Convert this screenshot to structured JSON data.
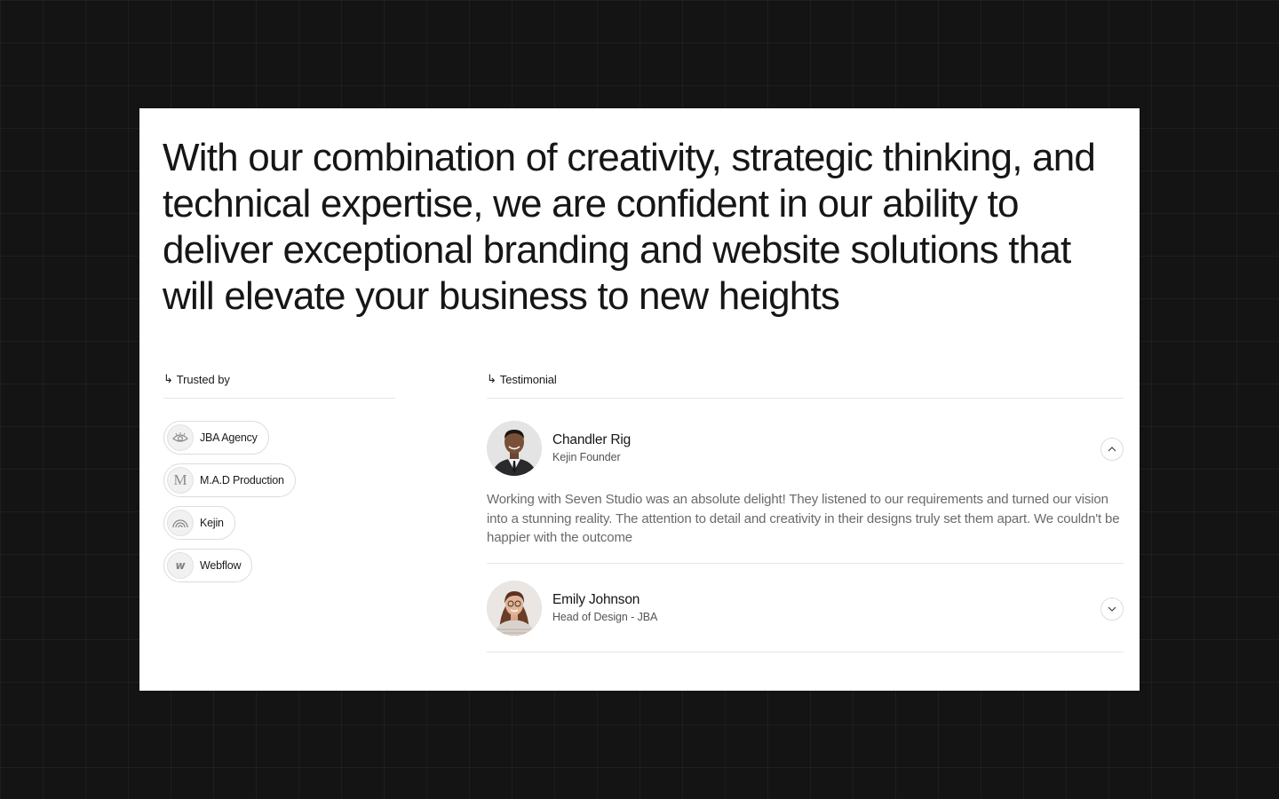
{
  "headline": "With our combination of creativity, strategic thinking, and technical expertise, we are confident in our ability to deliver exceptional branding and website solutions that will elevate your business to new heights",
  "trusted": {
    "label": "Trusted by",
    "arrow": "↳",
    "clients": [
      {
        "name": "JBA Agency",
        "icon": "eye-logo-icon"
      },
      {
        "name": "M.A.D Production",
        "icon": "m-letter-logo-icon",
        "glyph": "M"
      },
      {
        "name": "Kejin",
        "icon": "rainbow-arc-logo-icon"
      },
      {
        "name": "Webflow",
        "icon": "webflow-logo-icon",
        "glyph": "w"
      }
    ]
  },
  "testimonial": {
    "label": "Testimonial",
    "arrow": "↳",
    "items": [
      {
        "name": "Chandler Rig",
        "role": "Kejin Founder",
        "expanded": true,
        "toggle_icon": "chevron-up-icon",
        "quote": "Working with Seven Studio was an absolute delight! They listened to our requirements and turned our vision into a stunning reality. The attention to detail and creativity in their designs truly set them apart. We couldn't be happier with the outcome"
      },
      {
        "name": "Emily Johnson",
        "role": "Head of Design - JBA",
        "expanded": false,
        "toggle_icon": "chevron-down-icon"
      }
    ]
  },
  "colors": {
    "page_background": "#141414",
    "card_background": "#ffffff",
    "text_primary": "#161616",
    "text_muted": "#6a6a6a",
    "border": "#dcdcdc"
  }
}
